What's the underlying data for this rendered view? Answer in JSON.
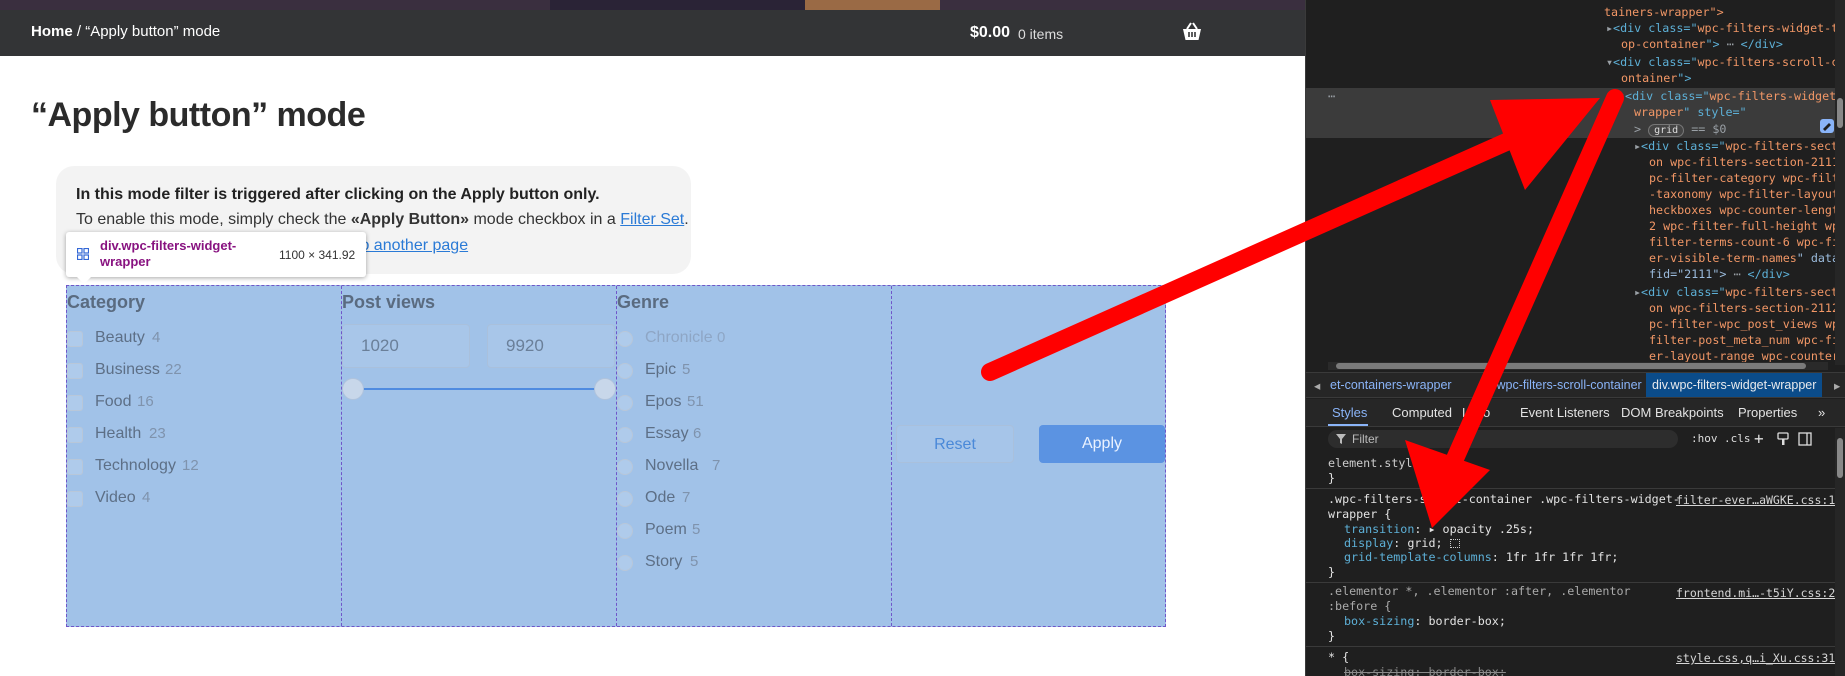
{
  "page": {
    "breadcrumb_home": "Home",
    "breadcrumb_sep": " / ",
    "breadcrumb_current": "“Apply button” mode",
    "cart_total": "$0.00",
    "cart_items": "0 items",
    "title": "“Apply button” mode"
  },
  "notice": {
    "line1": "In this mode filter is triggered after clicking on the Apply button only.",
    "line2_pre": "To enable this mode, simply check the ",
    "line2_bold": "«Apply Button»",
    "line2_mid": " mode checkbox in a ",
    "line2_link": "Filter Set",
    "line2_end": ".",
    "line3_link": "to another page"
  },
  "tooltip": {
    "selector": "div.wpc-filters-widget-wrapper",
    "dims": "1100 × 341.92"
  },
  "filters": {
    "category": {
      "title": "Category",
      "terms": [
        {
          "name": "Beauty",
          "count": "4"
        },
        {
          "name": "Business",
          "count": "22"
        },
        {
          "name": "Food",
          "count": "16"
        },
        {
          "name": "Health",
          "count": "23"
        },
        {
          "name": "Technology",
          "count": "12"
        },
        {
          "name": "Video",
          "count": "4"
        }
      ]
    },
    "post_views": {
      "title": "Post views",
      "min_value": "1020",
      "max_value": "9920"
    },
    "genre": {
      "title": "Genre",
      "terms": [
        {
          "name": "Chronicle",
          "count": "0"
        },
        {
          "name": "Epic",
          "count": "5"
        },
        {
          "name": "Epos",
          "count": "51"
        },
        {
          "name": "Essay",
          "count": "6"
        },
        {
          "name": "Novella",
          "count": "7"
        },
        {
          "name": "Ode",
          "count": "7"
        },
        {
          "name": "Poem",
          "count": "5"
        },
        {
          "name": "Story",
          "count": "5"
        }
      ]
    },
    "buttons": {
      "reset": "Reset",
      "apply": "Apply"
    }
  },
  "devtools": {
    "dom": {
      "l0": "tainers-wrapper\">",
      "l1a": "<div class=\"",
      "l1b": "wpc-filters-widget-t",
      "l1c": "op-container",
      "l1d": "\">",
      "l1e": "</div>",
      "l2a": "<div class=\"",
      "l2b": "wpc-filters-scroll-c",
      "l2c": "ontainer",
      "l2d": "\">",
      "l3a": "<div class=\"",
      "l3b": "wpc-filters-widget-",
      "l3c": "wrapper",
      "l3d": "\" style=\"",
      "l4a": "grid",
      "l4b": "== $0",
      "l5a": "<div class=\"",
      "l5b": "wpc-filters-secti",
      "l5c": "on wpc-filters-section-2111 w",
      "l5d": "pc-filter-category wpc-filter",
      "l5e": "-taxonomy wpc-filter-layout-c",
      "l5f": "heckboxes wpc-counter-length-",
      "l5g": "2 wpc-filter-full-height wpc-",
      "l5h": "filter-terms-count-6 wpc-filt",
      "l5i": "er-visible-term-names",
      "l5j": "\" data-",
      "l5k": "fid=\"2111\">",
      "l5l": "</div>",
      "l6a": "<div class=\"",
      "l6b": "wpc-filters-secti",
      "l6c": "on wpc-filters-section-2112 w",
      "l6d": "pc-filter-wpc_post_views wpc-",
      "l6e": "filter-post_meta_num wpc-filt",
      "l6f": "er-layout-range wpc-counter-l"
    },
    "crumbs": {
      "c1": "et-containers-wrapper",
      "c2": "div.wpc-filters-scroll-container",
      "c3": "div.wpc-filters-widget-wrapper"
    },
    "tabs": [
      "Styles",
      "Computed",
      "Layout",
      "Event Listeners",
      "DOM Breakpoints",
      "Properties"
    ],
    "filter_placeholder": "Filter",
    "hov": ":hov",
    "cls": ".cls",
    "styles": {
      "element_style": "element.style {",
      "close": "}",
      "rule1_sel_a": ".wpc-filters-scroll-container .wpc-filters-widget-",
      "rule1_sel_b": "wrapper {",
      "rule1_src": "filter-ever…aWGKE.css:1",
      "transition_prop": "transition",
      "transition_val": "opacity .25s;",
      "display_prop": "display",
      "display_val": "grid;",
      "gtc_prop": "grid-template-columns",
      "gtc_val": "1fr 1fr 1fr 1fr;",
      "rule2_sel_a": ".elementor *, .elementor :after, .elementor",
      "rule2_sel_b": ":before {",
      "rule2_src": "frontend.mi…-t5iY.css:2",
      "bs_prop": "box-sizing",
      "bs_val": "border-box;",
      "rule3_sel": "* {",
      "rule3_src": "style.css,q…i_Xu.css:31",
      "bs2": "box-sizing: border-box;"
    }
  },
  "colors": {
    "highlight": "#6fa1db",
    "arrow": "#ff0000",
    "apply_button": "#5b93e2",
    "navbar": "#333436"
  }
}
